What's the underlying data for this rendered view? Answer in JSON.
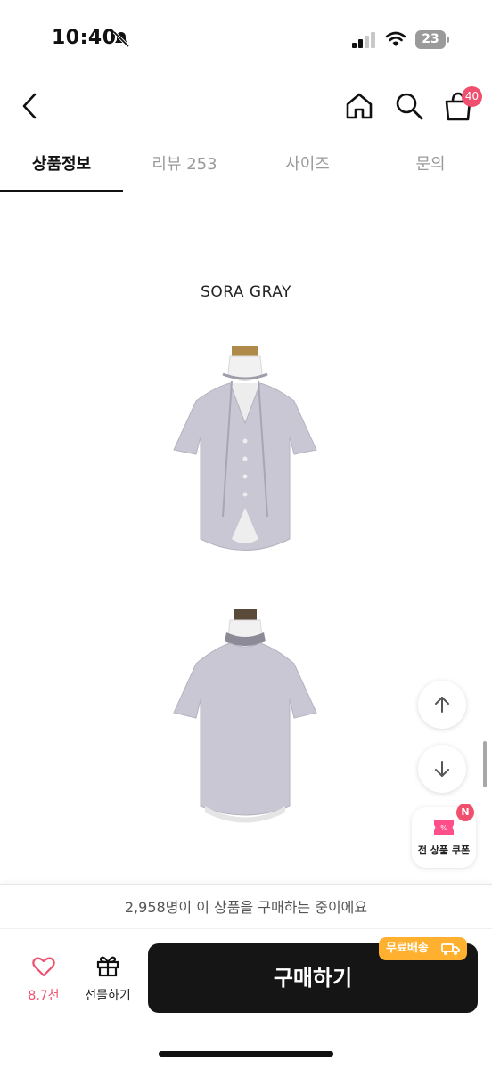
{
  "status_bar": {
    "time": "10:40",
    "battery": "23"
  },
  "nav": {
    "cart_badge": "40"
  },
  "tabs": [
    {
      "label": "상품정보",
      "active": true
    },
    {
      "label": "리뷰 253",
      "active": false
    },
    {
      "label": "사이즈",
      "active": false
    },
    {
      "label": "문의",
      "active": false
    }
  ],
  "content": {
    "heading": "SORA GRAY"
  },
  "floating": {
    "coupon_label": "전 상품 쿠폰",
    "coupon_badge": "N"
  },
  "bottom": {
    "buyers_text": "2,958명이 이 상품을 구매하는 중이에요",
    "like_count": "8.7천",
    "gift_label": "선물하기",
    "buy_label": "구매하기",
    "free_shipping": "무료배송"
  },
  "colors": {
    "accent_pink": "#f0506e",
    "shipping_orange": "#ffb02e",
    "buy_button": "#151515"
  }
}
